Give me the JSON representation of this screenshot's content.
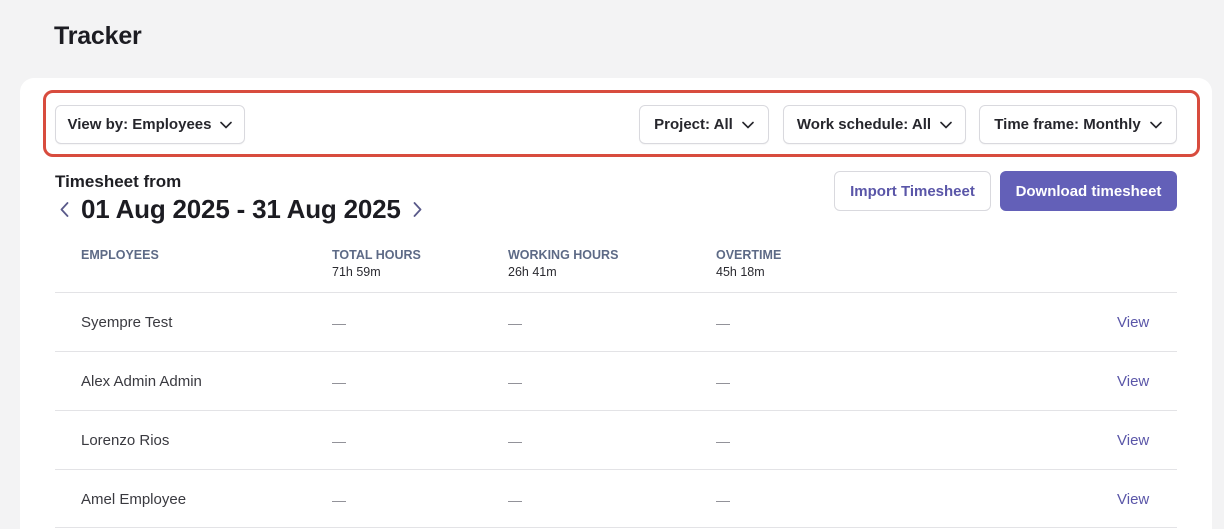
{
  "page": {
    "title": "Tracker"
  },
  "filters": {
    "view_by": "View by: Employees",
    "project": "Project: All",
    "work_schedule": "Work schedule: All",
    "time_frame": "Time frame: Monthly"
  },
  "timesheet": {
    "label": "Timesheet from",
    "range": "01 Aug 2025 - 31 Aug 2025"
  },
  "actions": {
    "import": "Import Timesheet",
    "download": "Download timesheet"
  },
  "table": {
    "headers": {
      "employees": "EMPLOYEES",
      "total_hours": "TOTAL HOURS",
      "working_hours": "WORKING HOURS",
      "overtime": "OVERTIME"
    },
    "totals": {
      "total_hours": "71h 59m",
      "working_hours": "26h 41m",
      "overtime": "45h 18m"
    },
    "rows": [
      {
        "name": "Syempre Test",
        "total": "—",
        "working": "—",
        "overtime": "—",
        "action": "View"
      },
      {
        "name": "Alex Admin Admin",
        "total": "—",
        "working": "—",
        "overtime": "—",
        "action": "View"
      },
      {
        "name": "Lorenzo Rios",
        "total": "—",
        "working": "—",
        "overtime": "—",
        "action": "View"
      },
      {
        "name": "Amel Employee",
        "total": "—",
        "working": "—",
        "overtime": "—",
        "action": "View"
      }
    ]
  },
  "colors": {
    "accent": "#6360b8",
    "link": "#5a56a8",
    "highlight": "#d84c3e"
  },
  "icons": {
    "dropdown": "chevron-down-icon",
    "prev": "chevron-left-icon",
    "next": "chevron-right-icon"
  }
}
